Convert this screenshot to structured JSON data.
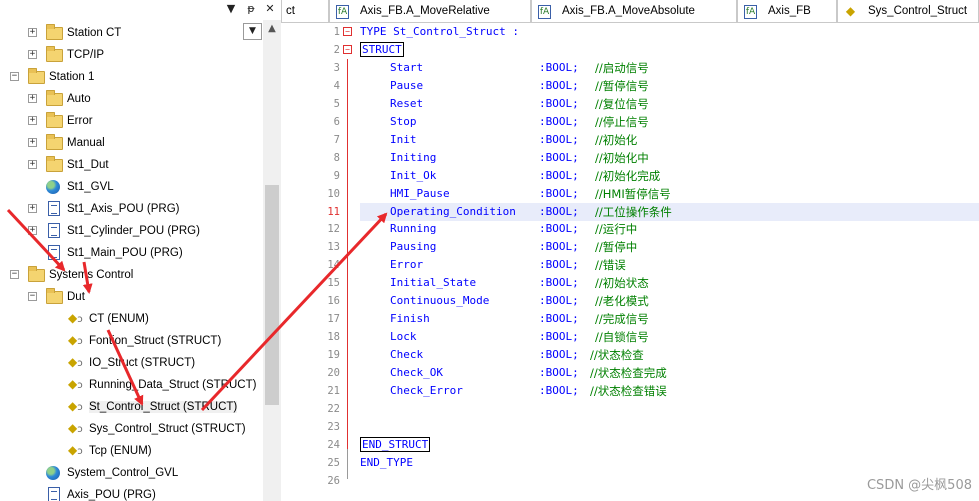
{
  "tree": {
    "header_buttons": {
      "dropdown": "▼",
      "pin": "ᵽ",
      "close": "✕"
    },
    "combo_arrow": "▼",
    "scroll_up": "▲",
    "items": [
      {
        "label": "Station CT",
        "icon": "folder",
        "expander": "+"
      },
      {
        "label": "TCP/IP",
        "icon": "folder",
        "expander": "+"
      },
      {
        "label": "Station 1",
        "icon": "folder",
        "expander": "−"
      },
      {
        "label": "Auto",
        "icon": "folder",
        "expander": "+"
      },
      {
        "label": "Error",
        "icon": "folder",
        "expander": "+"
      },
      {
        "label": "Manual",
        "icon": "folder",
        "expander": "+"
      },
      {
        "label": "St1_Dut",
        "icon": "folder",
        "expander": "+"
      },
      {
        "label": "St1_GVL",
        "icon": "globe",
        "expander": ""
      },
      {
        "label": "St1_Axis_POU (PRG)",
        "icon": "doc",
        "expander": "+"
      },
      {
        "label": "St1_Cylinder_POU (PRG)",
        "icon": "doc",
        "expander": "+"
      },
      {
        "label": "St1_Main_POU (PRG)",
        "icon": "doc",
        "expander": ""
      },
      {
        "label": "Systems Control",
        "icon": "folder",
        "expander": "−"
      },
      {
        "label": "Dut",
        "icon": "folder",
        "expander": "−"
      },
      {
        "label": "CT (ENUM)",
        "icon": "struct",
        "expander": ""
      },
      {
        "label": "Fontion_Struct (STRUCT)",
        "icon": "struct",
        "expander": ""
      },
      {
        "label": "IO_Struct (STRUCT)",
        "icon": "struct",
        "expander": ""
      },
      {
        "label": "Running_Data_Struct (STRUCT)",
        "icon": "struct",
        "expander": ""
      },
      {
        "label": "St_Control_Struct (STRUCT)",
        "icon": "struct",
        "expander": ""
      },
      {
        "label": "Sys_Control_Struct (STRUCT)",
        "icon": "struct",
        "expander": ""
      },
      {
        "label": "Tcp (ENUM)",
        "icon": "struct",
        "expander": ""
      },
      {
        "label": "System_Control_GVL",
        "icon": "globe",
        "expander": ""
      },
      {
        "label": "Axis_POU (PRG)",
        "icon": "doc",
        "expander": ""
      }
    ]
  },
  "tabs": [
    {
      "label": "ct"
    },
    {
      "label": "Axis_FB.A_MoveRelative"
    },
    {
      "label": "Axis_FB.A_MoveAbsolute"
    },
    {
      "label": "Axis_FB"
    },
    {
      "label": "Sys_Control_Struct"
    }
  ],
  "code": {
    "line_numbers": [
      "1",
      "2",
      "3",
      "4",
      "5",
      "6",
      "7",
      "8",
      "9",
      "10",
      "11",
      "12",
      "13",
      "14",
      "15",
      "16",
      "17",
      "18",
      "19",
      "20",
      "21",
      "22",
      "23",
      "24",
      "25",
      "26"
    ],
    "type_kw": "TYPE",
    "type_name": "St_Control_Struct :",
    "struct_kw": "STRUCT",
    "end_struct_kw": "END_STRUCT",
    "end_type_kw": "END_TYPE",
    "fields": [
      {
        "name": "Start",
        "type": ":BOOL;",
        "comment": "//启动信号"
      },
      {
        "name": "Pause",
        "type": ":BOOL;",
        "comment": "//暂停信号"
      },
      {
        "name": "Reset",
        "type": ":BOOL;",
        "comment": "//复位信号"
      },
      {
        "name": "Stop",
        "type": ":BOOL;",
        "comment": "//停止信号"
      },
      {
        "name": "Init",
        "type": ":BOOL;",
        "comment": "//初始化"
      },
      {
        "name": "Initing",
        "type": ":BOOL;",
        "comment": "//初始化中"
      },
      {
        "name": "Init_Ok",
        "type": ":BOOL;",
        "comment": "//初始化完成"
      },
      {
        "name": "HMI_Pause",
        "type": ":BOOL;",
        "comment": "//HMI暂停信号"
      },
      {
        "name": "Operating_Condition",
        "type": ":BOOL;",
        "comment": "//工位操作条件"
      },
      {
        "name": "Running",
        "type": ":BOOL;",
        "comment": "//运行中"
      },
      {
        "name": "Pausing",
        "type": ":BOOL;",
        "comment": "//暂停中"
      },
      {
        "name": "Error",
        "type": ":BOOL;",
        "comment": "//错误"
      },
      {
        "name": "Initial_State",
        "type": ":BOOL;",
        "comment": "//初始状态"
      },
      {
        "name": "Continuous_Mode",
        "type": ":BOOL;",
        "comment": "//老化模式"
      },
      {
        "name": "Finish",
        "type": ":BOOL;",
        "comment": "//完成信号"
      },
      {
        "name": "Lock",
        "type": ":BOOL;",
        "comment": "//自锁信号"
      },
      {
        "name": "Check",
        "type": ":BOOL;",
        "comment": "//状态检查"
      },
      {
        "name": "Check_OK",
        "type": ":BOOL;",
        "comment": "//状态检查完成"
      },
      {
        "name": "Check_Error",
        "type": ":BOOL;",
        "comment": "//状态检查错误"
      }
    ]
  },
  "watermark": "CSDN @尖枫508",
  "colors": {
    "keyword": "#0000ff",
    "comment": "#008000",
    "arrow": "#e8282b",
    "highlight": "#e8ecfa"
  }
}
